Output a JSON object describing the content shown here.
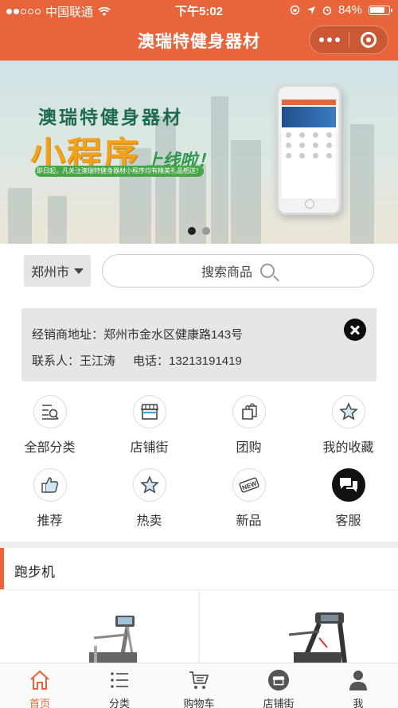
{
  "status_bar": {
    "carrier": "中国联通",
    "time": "下午5:02",
    "battery": "84%"
  },
  "nav": {
    "title": "澳瑞特健身器材"
  },
  "banner": {
    "title": "澳瑞特健身器材",
    "big_text": "小程序",
    "small_text": "上线啦！",
    "strip_text": "即日起，凡关注澳瑞特健身器材小程序均有精美礼品相送！",
    "active_slide": 1,
    "slide_count": 2
  },
  "search": {
    "city": "郑州市",
    "placeholder": "搜索商品"
  },
  "dealer": {
    "address_label": "经销商地址：",
    "address": "郑州市金水区健康路143号",
    "contact_label": "联系人：",
    "contact": "王江涛",
    "phone_label": "电话：",
    "phone": "13213191419"
  },
  "menu": [
    {
      "label": "全部分类",
      "icon": "list-search-icon"
    },
    {
      "label": "店铺街",
      "icon": "store-icon"
    },
    {
      "label": "团购",
      "icon": "shopping-bag-icon"
    },
    {
      "label": "我的收藏",
      "icon": "star-icon"
    },
    {
      "label": "推荐",
      "icon": "thumbs-up-icon"
    },
    {
      "label": "热卖",
      "icon": "star-icon"
    },
    {
      "label": "新品",
      "icon": "new-badge-icon"
    },
    {
      "label": "客服",
      "icon": "chat-icon"
    }
  ],
  "category": {
    "title": "跑步机"
  },
  "tabs": [
    {
      "label": "首页",
      "icon": "home-icon",
      "active": true
    },
    {
      "label": "分类",
      "icon": "list-icon",
      "active": false
    },
    {
      "label": "购物车",
      "icon": "cart-icon",
      "active": false
    },
    {
      "label": "店铺街",
      "icon": "store-icon",
      "active": false
    },
    {
      "label": "我",
      "icon": "user-icon",
      "active": false
    }
  ],
  "colors": {
    "brand": "#e8653b",
    "text": "#333333"
  }
}
